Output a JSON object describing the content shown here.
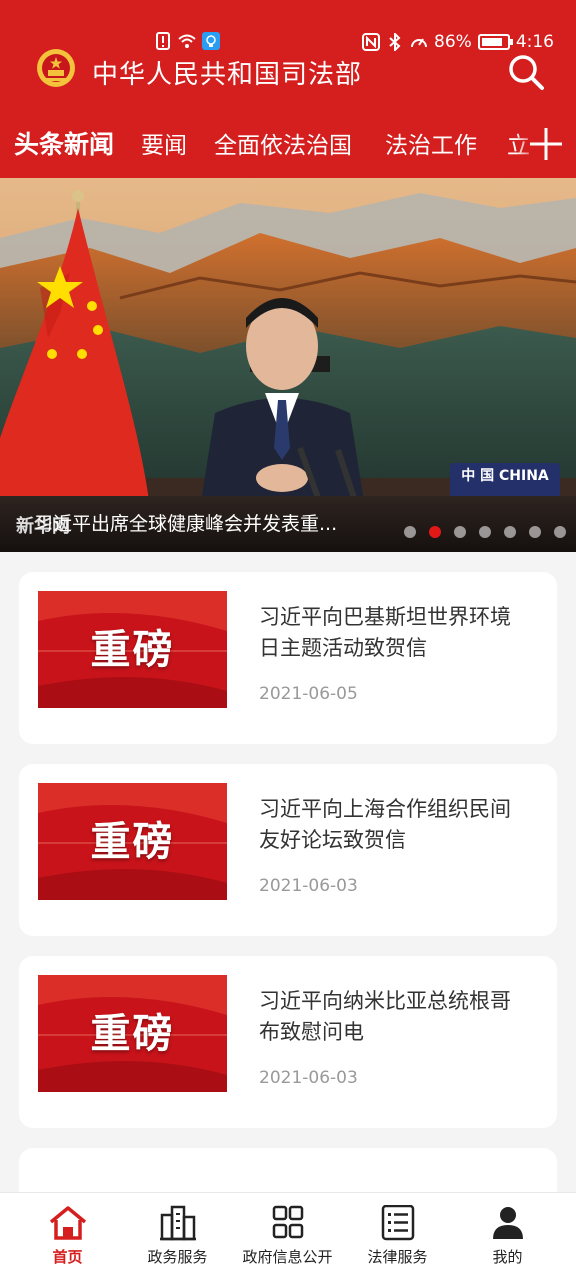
{
  "status_bar": {
    "battery": "86%",
    "battery_level": 0.86,
    "time": "4:16"
  },
  "header": {
    "title": "中华人民共和国司法部"
  },
  "tabs": [
    {
      "label": "头条新闻",
      "active": true
    },
    {
      "label": "要闻"
    },
    {
      "label": "全面依法治国"
    },
    {
      "label": "法治工作"
    },
    {
      "label": "立"
    }
  ],
  "hero": {
    "caption": "习近平出席全球健康峰会并发表重...",
    "watermark": "新华网",
    "backdrop_label": "中 国 CHINA",
    "slide_count": 7,
    "active_slide": 2
  },
  "news": [
    {
      "thumb_text": "重磅",
      "title": "习近平向巴基斯坦世界环境日主题活动致贺信",
      "date": "2021-06-05"
    },
    {
      "thumb_text": "重磅",
      "title": "习近平向上海合作组织民间友好论坛致贺信",
      "date": "2021-06-03"
    },
    {
      "thumb_text": "重磅",
      "title": "习近平向纳米比亚总统根哥布致慰问电",
      "date": "2021-06-03"
    }
  ],
  "bottom_nav": [
    {
      "label": "首页",
      "icon": "home-icon",
      "active": true
    },
    {
      "label": "政务服务",
      "icon": "building-icon"
    },
    {
      "label": "政府信息公开",
      "icon": "grid-icon"
    },
    {
      "label": "法律服务",
      "icon": "list-icon"
    },
    {
      "label": "我的",
      "icon": "person-icon"
    }
  ],
  "colors": {
    "primary": "#d51f1f",
    "active_dot": "#e11818",
    "date": "#999999"
  }
}
